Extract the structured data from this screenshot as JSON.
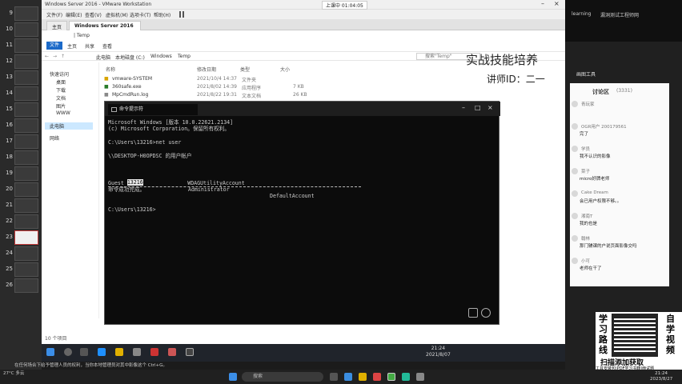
{
  "slide_panel": {
    "numbers": [
      "9",
      "10",
      "11",
      "12",
      "13",
      "14",
      "15",
      "16",
      "17",
      "18",
      "19",
      "20",
      "21",
      "22",
      "23",
      "24",
      "25",
      "26"
    ]
  },
  "vmware": {
    "title": "Windows Server 2016 - VMware Workstation",
    "menu": [
      "文件(F)",
      "编辑(E)",
      "查看(V)",
      "虚拟机(M)",
      "选项卡(T)",
      "帮助(H)"
    ],
    "banner": "上课中 01:04:05",
    "tabs": [
      "主页",
      "Windows Server 2016"
    ]
  },
  "explorer": {
    "title_path": "| Temp",
    "ribbon_tabs": [
      "文件",
      "主页",
      "共享",
      "查看"
    ],
    "breadcrumbs": [
      "此电脑",
      "本地磁盘 (C:)",
      "Windows",
      "Temp"
    ],
    "search_placeholder": "搜索\"Temp\"",
    "nav": [
      "快速访问",
      "桌面",
      "下载",
      "文档",
      "图片",
      "WWW",
      "此电脑",
      "网络"
    ],
    "columns": [
      "名称",
      "修改日期",
      "类型",
      "大小"
    ],
    "files": [
      {
        "name": "vmware-SYSTEM",
        "date": "2021/10/4 14:37",
        "type": "文件夹",
        "size": ""
      },
      {
        "name": "360safe.exe",
        "date": "2021/8/02 14:39",
        "type": "应用程序",
        "size": "7 KB"
      },
      {
        "name": "MpCmdRun.log",
        "date": "2021/8/22 19:31",
        "type": "文本文档",
        "size": "26 KB"
      }
    ],
    "status": "10 个项目"
  },
  "watermark": {
    "title": "实战技能培养",
    "teacher": "讲师ID：二一"
  },
  "cmd": {
    "tab_title": "命令提示符",
    "lines": [
      "Microsoft Windows [版本 10.0.22621.2134]",
      "(c) Microsoft Corporation。保留所有权利。",
      "",
      "C:\\Users\\13216>net user",
      "",
      "\\\\DESKTOP-H0OPDSC 的用户帐户",
      "",
      "",
      "",
      "Guest                    WDAGUtilityAccount",
      "命令成功完成。",
      "",
      "",
      "C:\\Users\\13216>"
    ],
    "user_row": {
      "highlighted": "13216",
      "col2": "Administrator",
      "col3": "DefaultAccount"
    }
  },
  "right_panel": {
    "tab_a": "learning",
    "tab_b": "漏洞测试工程师网",
    "tool_label": "画图工具",
    "heading": "讨论区",
    "count": "(3331)",
    "chat": [
      {
        "name": "青玩家",
        "msg": ""
      },
      {
        "name": "OGR用户 200179561",
        "msg": "完了"
      },
      {
        "name": "学员",
        "msg": "我不认识的影像"
      },
      {
        "name": "菜子",
        "msg": "micro好牌老师"
      },
      {
        "name": "Cake Dream",
        "msg": "会已用户权限不够。。"
      },
      {
        "name": "湘南T",
        "msg": "我的也是"
      },
      {
        "name": "翰林",
        "msg": "那门辅课的户说页面影像交吗"
      },
      {
        "name": "小可",
        "msg": "老师在干了"
      }
    ]
  },
  "promo": {
    "left": "学习路线",
    "right": "自学视频",
    "cta": "扫描添加获取",
    "sub": "工具安装包|PDF学习书籍|面试题"
  },
  "subtitle": "在任何场合下给予管理人员的权利，当你本地管理员对其中影像这个 Ctrl+G。",
  "guest_clock": {
    "time": "21:24",
    "date": "2021/8/07"
  },
  "host": {
    "search_placeholder": "搜索",
    "weather": "27°C 多云",
    "time": "21:24",
    "date": "2023/8/27"
  }
}
